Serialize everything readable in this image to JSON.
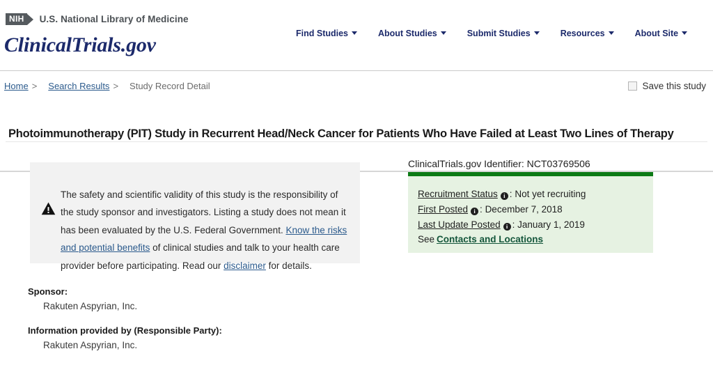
{
  "header": {
    "nih_logo_text": "NIH",
    "agency_name": "U.S. National Library of Medicine",
    "wordmark": "ClinicalTrials.gov",
    "nav_items": [
      {
        "label": "Find Studies"
      },
      {
        "label": "About Studies"
      },
      {
        "label": "Submit Studies"
      },
      {
        "label": "Resources"
      },
      {
        "label": "About Site"
      }
    ]
  },
  "breadcrumb": {
    "home": "Home",
    "search_results": "Search Results",
    "current": "Study Record Detail",
    "separator": ">"
  },
  "save_study": {
    "label": "Save this study",
    "checked": false
  },
  "study": {
    "title": "Photoimmunotherapy (PIT) Study in Recurrent Head/Neck Cancer for Patients Who Have Failed at Least Two Lines of Therapy"
  },
  "disclaimer": {
    "part1": "The safety and scientific validity of this study is the responsibility of the study sponsor and investigators. Listing a study does not mean it has been evaluated by the U.S. Federal Government. ",
    "link1": "Know the risks and potential benefits",
    "part2": " of clinical studies and talk to your health care provider before participating. Read our ",
    "link2": "disclaimer",
    "part3": " for details."
  },
  "status_panel": {
    "identifier_label": "ClinicalTrials.gov Identifier:",
    "identifier_value": "NCT03769506",
    "rows": [
      {
        "key": "Recruitment Status",
        "value": "Not yet recruiting"
      },
      {
        "key": "First Posted",
        "value": "December 7, 2018"
      },
      {
        "key": "Last Update Posted",
        "value": "January 1, 2019"
      }
    ],
    "separator": ":",
    "see_text": "See",
    "contacts_link": "Contacts and Locations",
    "accent_color": "#0c7a15",
    "panel_color": "#e6f2e2"
  },
  "sponsor_section": {
    "sponsor_label": "Sponsor:",
    "sponsor_value": "Rakuten Aspyrian, Inc.",
    "responsible_label": "Information provided by (Responsible Party):",
    "responsible_value": "Rakuten Aspyrian, Inc."
  }
}
